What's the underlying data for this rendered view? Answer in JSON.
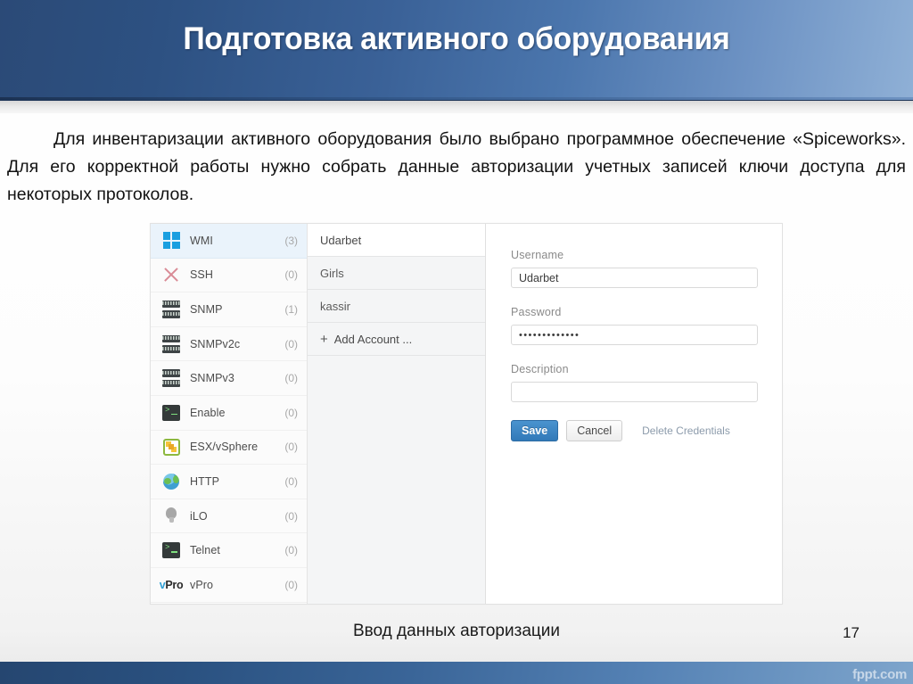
{
  "slide": {
    "title": "Подготовка активного оборудования",
    "body": "Для инвентаризации активного оборудования было выбрано программное обеспечение «Spiceworks». Для его корректной работы нужно собрать данные авторизации учетных записей ключи доступа для некоторых протоколов.",
    "caption": "Ввод данных авторизации",
    "page_number": "17",
    "watermark": "fppt.com",
    "colors": {
      "header_dark": "#2b4a77",
      "header_light": "#8fb0d6",
      "accent_blue": "#3179b8",
      "selected_row": "#eaf3fb"
    }
  },
  "app": {
    "protocols": [
      {
        "icon": "windows-icon",
        "label": "WMI",
        "count": "(3)",
        "selected": true
      },
      {
        "icon": "red-x-icon",
        "label": "SSH",
        "count": "(0)",
        "selected": false
      },
      {
        "icon": "server-icon",
        "label": "SNMP",
        "count": "(1)",
        "selected": false
      },
      {
        "icon": "server-icon",
        "label": "SNMPv2c",
        "count": "(0)",
        "selected": false
      },
      {
        "icon": "server-icon",
        "label": "SNMPv3",
        "count": "(0)",
        "selected": false
      },
      {
        "icon": "terminal-icon",
        "label": "Enable",
        "count": "(0)",
        "selected": false
      },
      {
        "icon": "vsphere-icon",
        "label": "ESX/vSphere",
        "count": "(0)",
        "selected": false
      },
      {
        "icon": "globe-icon",
        "label": "HTTP",
        "count": "(0)",
        "selected": false
      },
      {
        "icon": "bulb-icon",
        "label": "iLO",
        "count": "(0)",
        "selected": false
      },
      {
        "icon": "terminal-icon",
        "label": "Telnet",
        "count": "(0)",
        "selected": false
      },
      {
        "icon": "vpro-icon",
        "label": "vPro",
        "count": "(0)",
        "selected": false
      }
    ],
    "accounts": [
      {
        "label": "Udarbet",
        "selected": true
      },
      {
        "label": "Girls",
        "selected": false
      },
      {
        "label": "kassir",
        "selected": false
      }
    ],
    "add_account": {
      "plus": "+",
      "label": "Add Account ..."
    },
    "form": {
      "username_label": "Username",
      "username_value": "Udarbet",
      "password_label": "Password",
      "password_value": "•••••••••••••",
      "description_label": "Description",
      "description_value": "",
      "save_label": "Save",
      "cancel_label": "Cancel",
      "delete_label": "Delete Credentials"
    }
  }
}
